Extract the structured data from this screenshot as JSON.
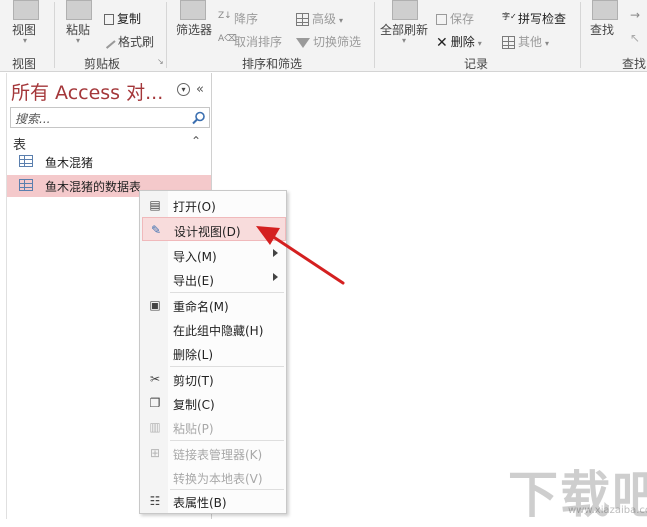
{
  "ribbon": {
    "view_label": "视图",
    "paste_label": "粘贴",
    "copy_label": "复制",
    "format_painter_label": "格式刷",
    "filter_label": "筛选器",
    "descending_label": "降序",
    "remove_sort_label": "取消排序",
    "advanced_label": "高级",
    "toggle_filter_label": "切换筛选",
    "refresh_all_label": "全部刷新",
    "save_label": "保存",
    "delete_label": "删除",
    "spelling_label": "拼写检查",
    "other_label": "其他",
    "find_label": "查找",
    "groups": {
      "views": "视图",
      "clipboard": "剪贴板",
      "sort_filter": "排序和筛选",
      "records": "记录",
      "find": "查找"
    }
  },
  "nav": {
    "title": "所有 Access 对...",
    "collapse_glyph": "«",
    "search_placeholder": "搜索...",
    "category": "表",
    "category_toggle": "⌃",
    "items": [
      {
        "label": "鱼木混猪",
        "selected": false
      },
      {
        "label": "鱼木混猪的数据表",
        "selected": true
      }
    ]
  },
  "context_menu": {
    "items": [
      {
        "label": "打开(O)",
        "icon": "open-icon",
        "enabled": true,
        "submenu": false
      },
      {
        "label": "设计视图(D)",
        "icon": "design-view-icon",
        "enabled": true,
        "submenu": false,
        "highlighted": true
      },
      {
        "label": "导入(M)",
        "icon": "",
        "enabled": true,
        "submenu": true
      },
      {
        "label": "导出(E)",
        "icon": "",
        "enabled": true,
        "submenu": true
      },
      {
        "label": "重命名(M)",
        "icon": "rename-icon",
        "enabled": true,
        "submenu": false
      },
      {
        "label": "在此组中隐藏(H)",
        "icon": "",
        "enabled": true,
        "submenu": false
      },
      {
        "label": "删除(L)",
        "icon": "",
        "enabled": true,
        "submenu": false
      },
      {
        "label": "剪切(T)",
        "icon": "scissors-icon",
        "enabled": true,
        "submenu": false
      },
      {
        "label": "复制(C)",
        "icon": "copy-icon",
        "enabled": true,
        "submenu": false
      },
      {
        "label": "粘贴(P)",
        "icon": "paste-icon",
        "enabled": false,
        "submenu": false
      },
      {
        "label": "链接表管理器(K)",
        "icon": "linked-table-icon",
        "enabled": false,
        "submenu": false
      },
      {
        "label": "转换为本地表(V)",
        "icon": "",
        "enabled": false,
        "submenu": false
      },
      {
        "label": "表属性(B)",
        "icon": "properties-icon",
        "enabled": true,
        "submenu": false
      }
    ]
  },
  "watermark": {
    "text": "下载吧",
    "url": "www.xiazaiba.com"
  },
  "colors": {
    "nav_title": "#a4373a",
    "selection": "#f4c9cb",
    "arrow": "#d42020"
  }
}
